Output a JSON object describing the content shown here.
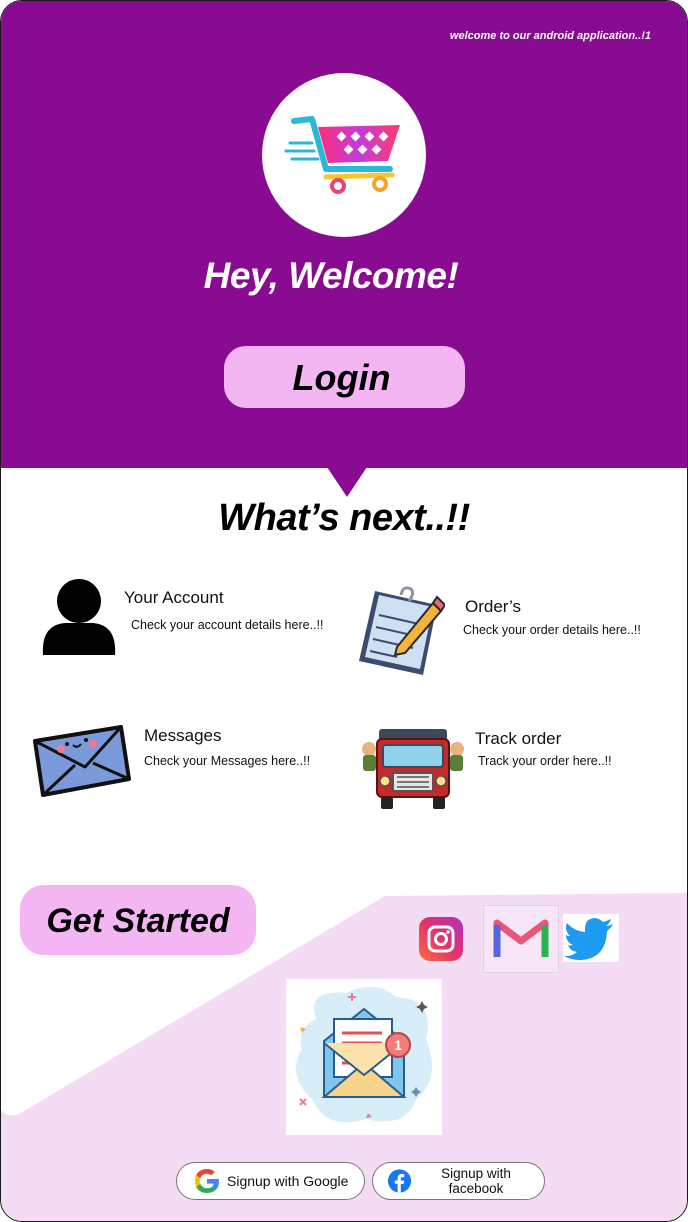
{
  "header": {
    "tagline": "welcome to our android  application..!1",
    "welcome": "Hey, Welcome!",
    "login_label": "Login",
    "logo_icon": "shopping-cart-icon"
  },
  "section": {
    "title": "What’s next..!!"
  },
  "features": {
    "account": {
      "title": "Your Account",
      "desc": "Check your account details here..!!",
      "icon": "user-icon"
    },
    "orders": {
      "title": "Order’s",
      "desc": "Check your order details here..!!",
      "icon": "notepad-icon"
    },
    "messages": {
      "title": "Messages",
      "desc": "Check your Messages  here..!!",
      "icon": "envelope-icon"
    },
    "track": {
      "title": "Track order",
      "desc": "Track your order here..!!",
      "icon": "truck-icon"
    }
  },
  "cta": {
    "get_started_label": "Get Started"
  },
  "social": [
    "instagram-icon",
    "gmail-icon",
    "twitter-icon"
  ],
  "signup": {
    "google_label": "Signup with Google",
    "facebook_label": "Signup with facebook"
  },
  "colors": {
    "brand_purple": "#880b92",
    "button_pink": "#f3b6f3",
    "lower_bg": "#f5dcf5"
  }
}
